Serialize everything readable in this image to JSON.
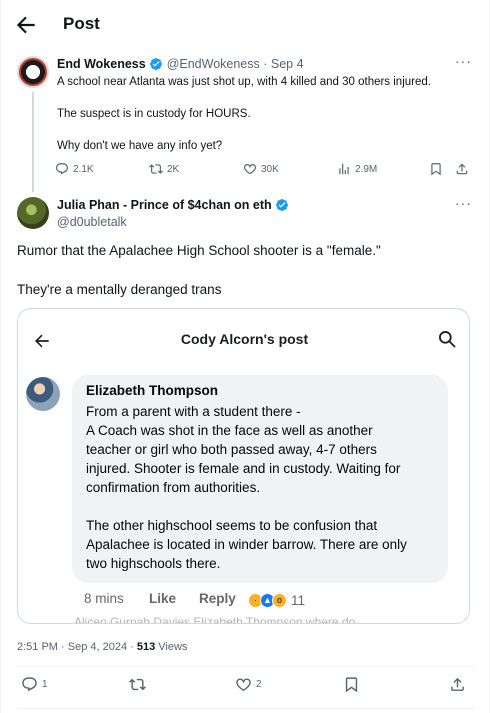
{
  "header": {
    "title": "Post"
  },
  "parent_tweet": {
    "name": "End Wokeness",
    "handle": "@EndWokeness",
    "date": "Sep 4",
    "lines": [
      "A school near Atlanta was just shot up, with 4 killed and 30 others injured.",
      "The suspect is in custody for HOURS.",
      "Why don't we have any info yet?"
    ],
    "replies": "2.1K",
    "reposts": "2K",
    "likes": "30K",
    "views": "2.9M"
  },
  "main_tweet": {
    "name": "Julia Phan - Prince of $4chan on eth",
    "handle": "@d0ubletalk",
    "lines": [
      "Rumor that the Apalachee High School shooter is a \"female.\"",
      "They're a mentally deranged trans"
    ],
    "timestamp": "2:51 PM · Sep 4, 2024 · ",
    "views": "513",
    "views_label": " Views",
    "replies": "1",
    "likes": "2"
  },
  "embedded_post": {
    "title": "Cody Alcorn's post",
    "author": "Elizabeth Thompson",
    "lines": [
      "From a parent with a student there -",
      "A Coach was shot in the face as well as another",
      "teacher or girl who both passed away, 4-7 others",
      "injured. Shooter is female and in custody. Waiting for",
      "confirmation from authorities.",
      "The other highschool seems to be confusion that",
      "Apalachee is located in winder barrow. There are only",
      "two highschools there."
    ],
    "time": "8 mins",
    "like_label": "Like",
    "reply_label": "Reply",
    "reaction_count": "11",
    "cutoff_text": "Alicen Gurnah Davies  Elizabeth Thompson  where do"
  },
  "colors": {
    "verified": "#1d9bf0",
    "muted": "#536471",
    "fb_bubble": "#f0f2f5"
  }
}
